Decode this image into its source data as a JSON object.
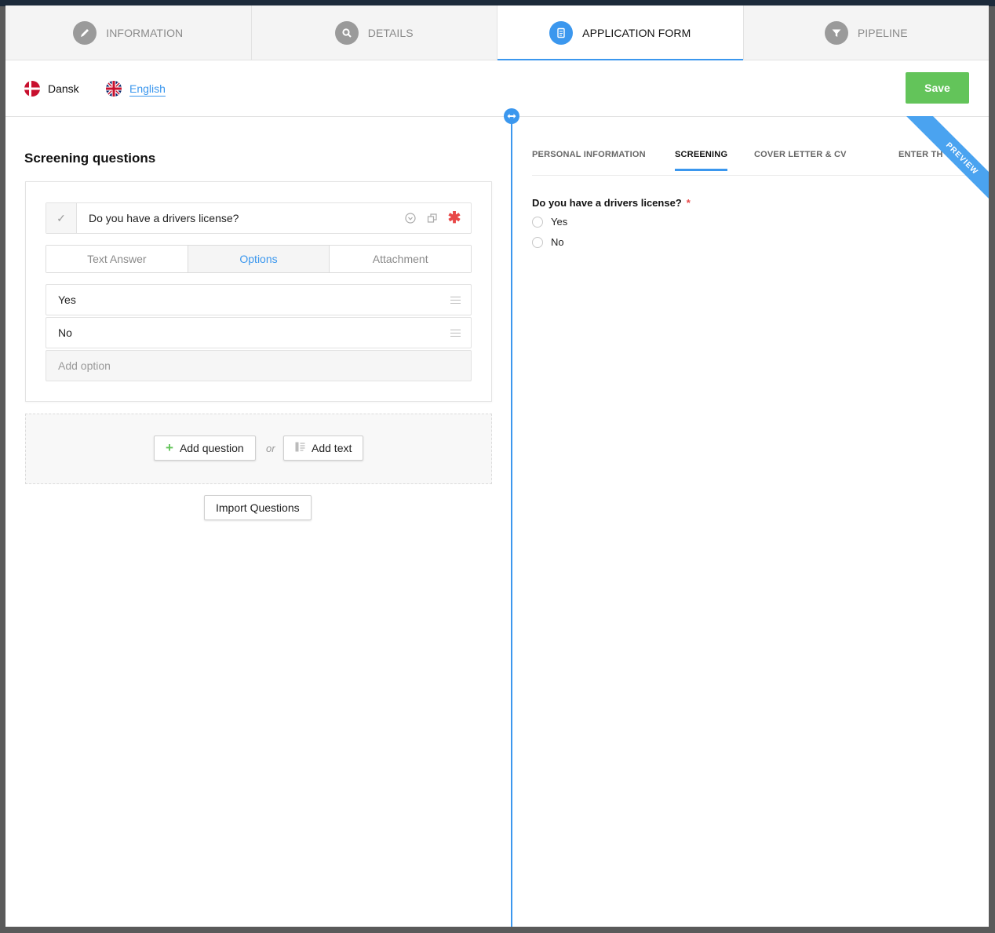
{
  "tabs": [
    {
      "label": "INFORMATION",
      "icon": "pencil-icon",
      "active": false
    },
    {
      "label": "DETAILS",
      "icon": "search-icon",
      "active": false
    },
    {
      "label": "APPLICATION FORM",
      "icon": "form-icon",
      "active": true
    },
    {
      "label": "PIPELINE",
      "icon": "funnel-icon",
      "active": false
    }
  ],
  "languages": [
    {
      "label": "Dansk",
      "flag": "denmark-flag-icon",
      "selected": false
    },
    {
      "label": "English",
      "flag": "uk-flag-icon",
      "selected": true
    }
  ],
  "save_label": "Save",
  "screening": {
    "title": "Screening questions",
    "question": "Do you have a drivers license?",
    "answer_types": [
      "Text Answer",
      "Options",
      "Attachment"
    ],
    "selected_answer_type": "Options",
    "options": [
      "Yes",
      "No"
    ],
    "add_option_placeholder": "Add option",
    "add_question_label": "Add question",
    "or_label": "or",
    "add_text_label": "Add text",
    "import_label": "Import Questions"
  },
  "preview": {
    "ribbon": "PREVIEW",
    "tabs": [
      "PERSONAL INFORMATION",
      "SCREENING",
      "COVER LETTER & CV",
      "ENTER TH"
    ],
    "active_tab": "SCREENING",
    "question": "Do you have a drivers license?",
    "required_mark": "*",
    "options": [
      "Yes",
      "No"
    ]
  },
  "colors": {
    "accent": "#3b97ee",
    "save": "#63c45a",
    "required": "#e84848"
  }
}
